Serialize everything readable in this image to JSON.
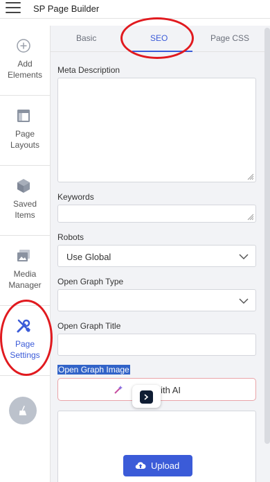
{
  "app": {
    "title": "SP Page Builder"
  },
  "sidebar": {
    "items": [
      {
        "label": "Add\nElements",
        "icon": "plus-circle-icon"
      },
      {
        "label": "Page\nLayouts",
        "icon": "layout-icon"
      },
      {
        "label": "Saved\nItems",
        "icon": "cube-icon"
      },
      {
        "label": "Media\nManager",
        "icon": "images-icon"
      },
      {
        "label": "Page\nSettings",
        "icon": "wrench-screwdriver-icon"
      }
    ],
    "bottom_icon": "broom-icon"
  },
  "tabs": {
    "basic": "Basic",
    "seo": "SEO",
    "page_css": "Page CSS",
    "active": "SEO"
  },
  "fields": {
    "meta_description": {
      "label": "Meta Description",
      "value": ""
    },
    "keywords": {
      "label": "Keywords",
      "value": ""
    },
    "robots": {
      "label": "Robots",
      "value": "Use Global"
    },
    "og_type": {
      "label": "Open Graph Type",
      "value": ""
    },
    "og_title": {
      "label": "Open Graph Title",
      "value": ""
    },
    "og_image": {
      "label": "Open Graph Image",
      "generate_label": "ate with AI",
      "upload_label": "Upload"
    }
  },
  "colors": {
    "accent": "#3b5bd8",
    "annotation": "#e11a1f",
    "selection": "#3163c8"
  }
}
